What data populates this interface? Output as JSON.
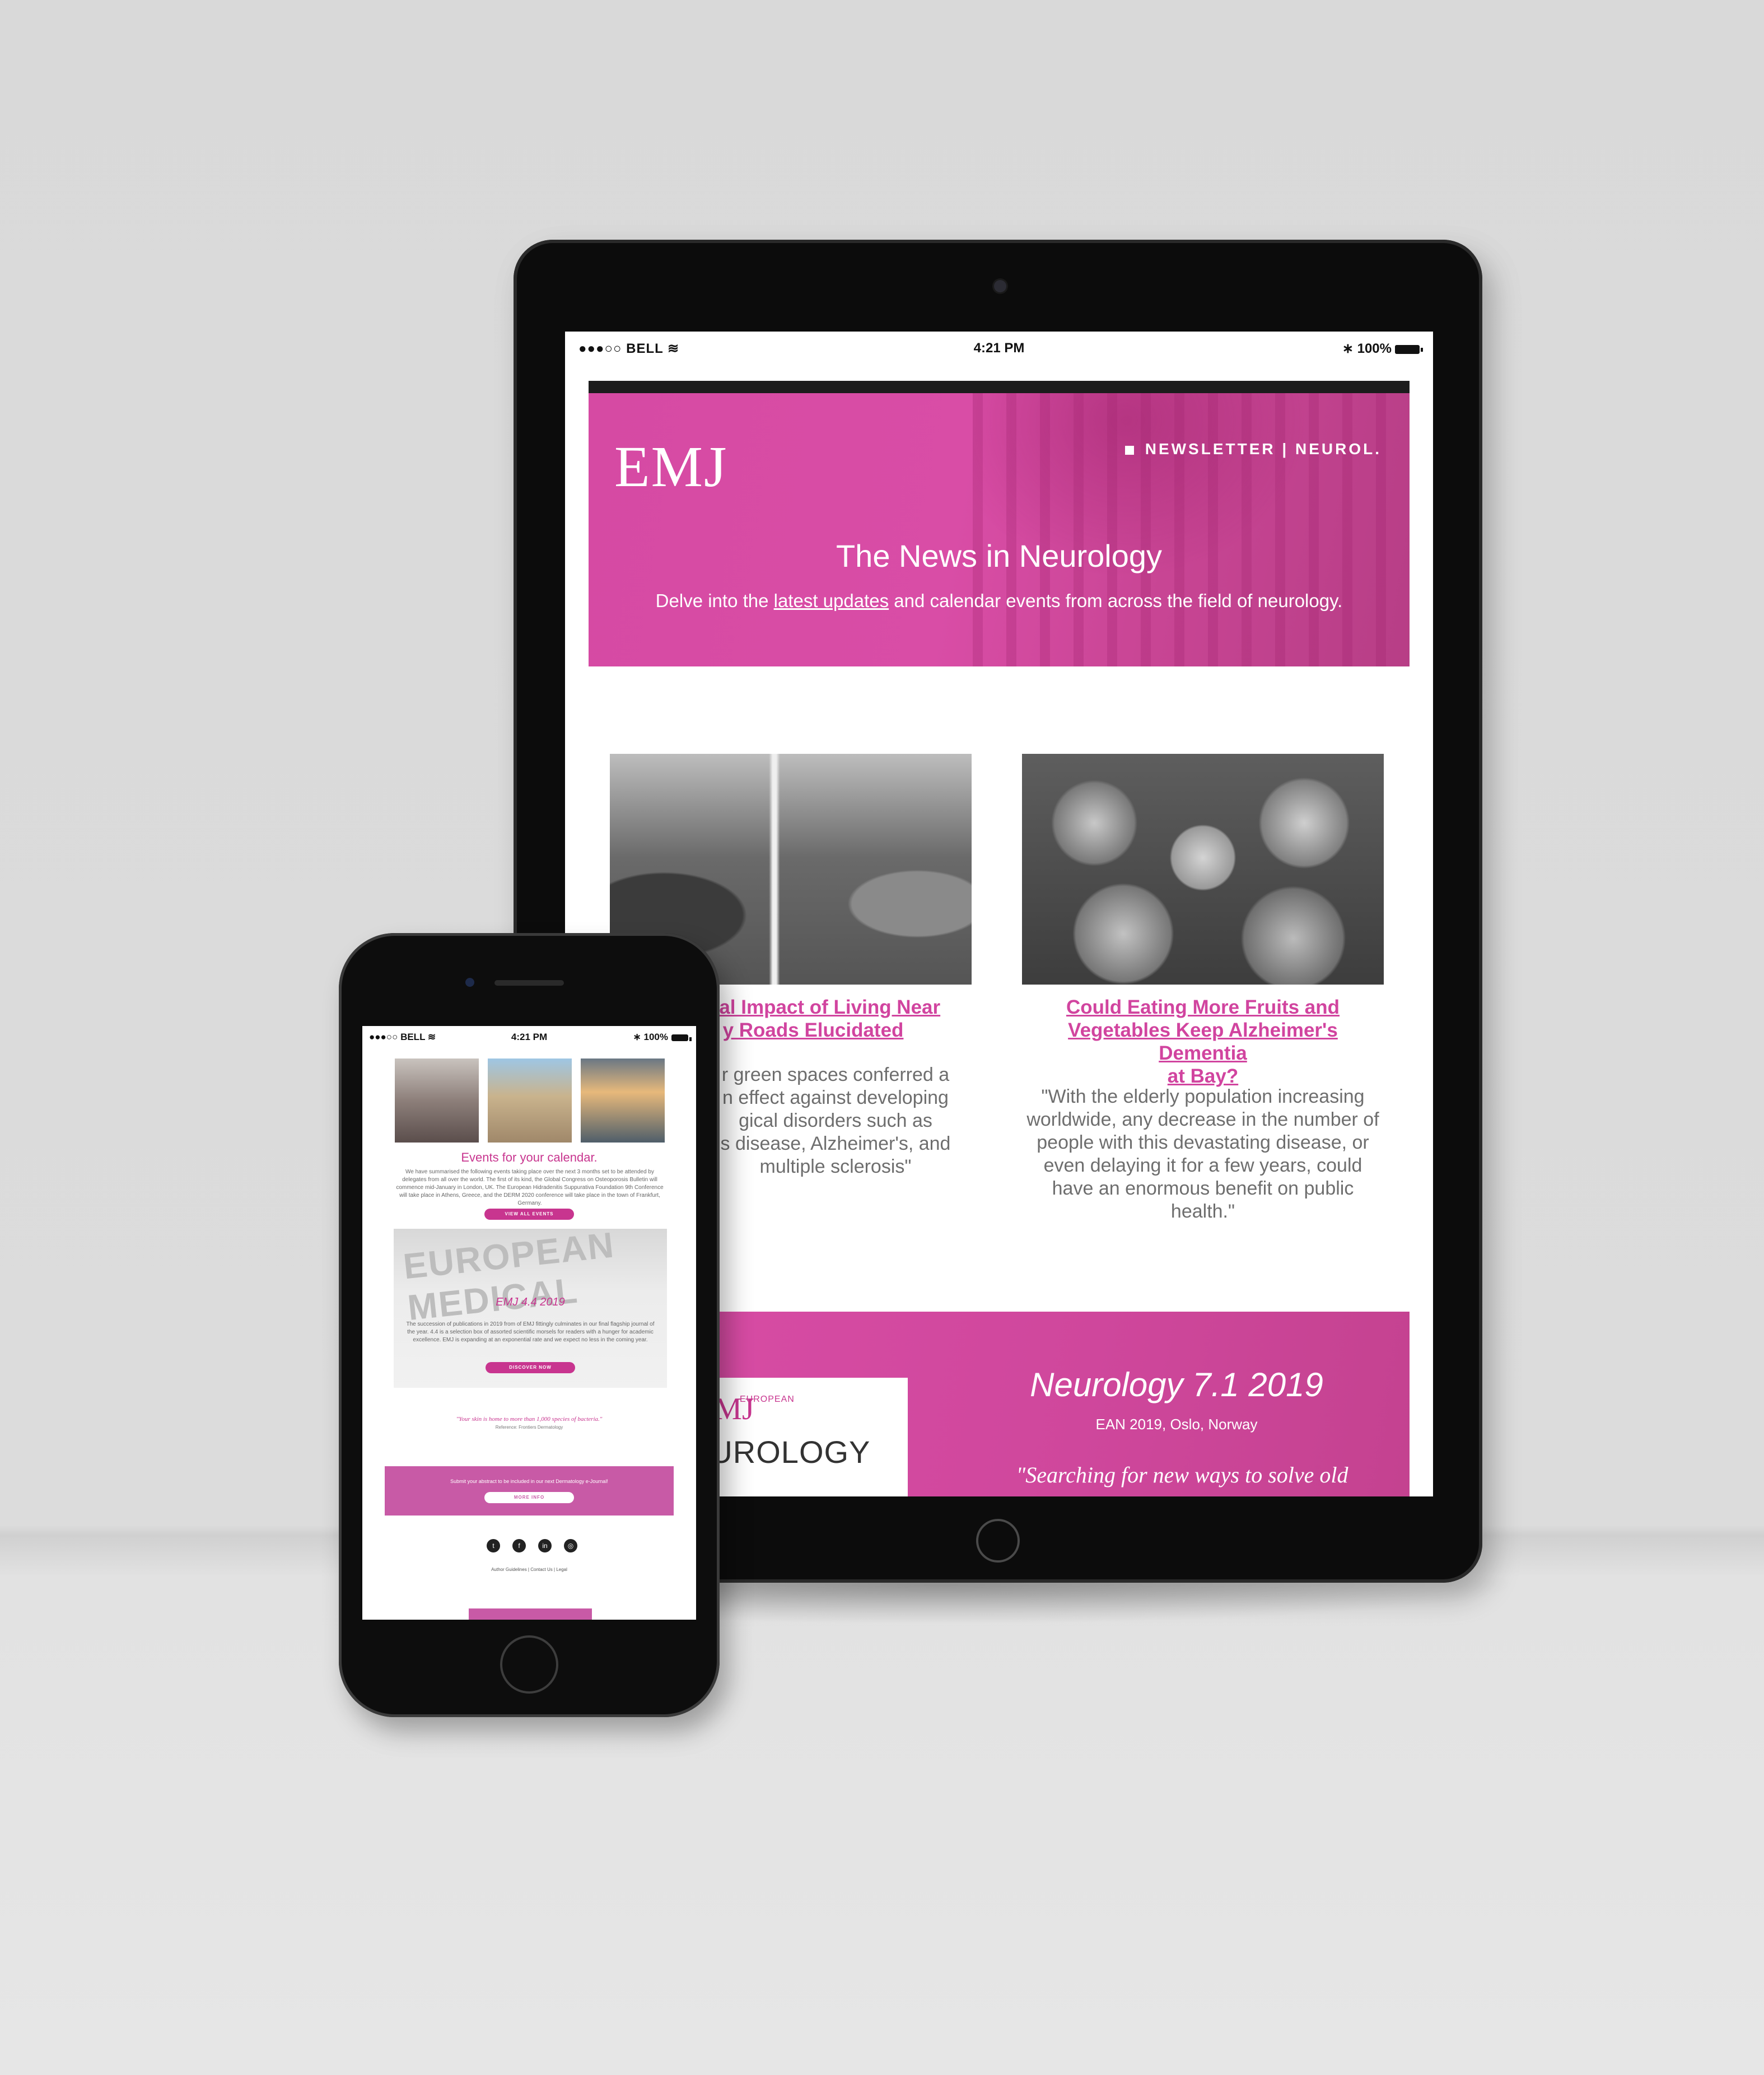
{
  "tablet": {
    "status": {
      "carrier": "●●●○○ BELL",
      "time": "4:21 PM",
      "battery": "100%"
    },
    "header": {
      "logo": "EMJ",
      "label": "NEWSLETTER | NEUROL.",
      "title": "The News in Neurology",
      "subtitle_pre": "Delve into the ",
      "subtitle_link": "latest updates",
      "subtitle_post": " and calendar events from across the field of neurology."
    },
    "articles": [
      {
        "title_l1": "cal Impact of Living Near",
        "title_l2": "y Roads Elucidated",
        "body_lines": [
          "r green spaces conferred a",
          "n effect against developing",
          "gical disorders such as",
          "s disease, Alzheimer's, and",
          "multiple sclerosis\""
        ]
      },
      {
        "title_l1": "Could Eating More Fruits and",
        "title_l2": "Vegetables Keep Alzheimer's Dementia",
        "title_l3": "at Bay?",
        "body_lines": [
          "\"With the elderly population increasing",
          "worldwide, any decrease in the number of",
          "people with this devastating disease, or",
          "even delaying it for a few years, could",
          "have an enormous benefit on public",
          "health.\""
        ]
      }
    ],
    "footer": {
      "cover_brand": "EMJ",
      "cover_publisher": "EUROPEAN",
      "cover_title": "EUROLOGY",
      "title": "Neurology 7.1 2019",
      "subtitle": "EAN 2019, Oslo, Norway",
      "quote": "\"Searching for new ways to solve old"
    }
  },
  "phone": {
    "status": {
      "carrier": "●●●○○ BELL",
      "time": "4:21 PM",
      "battery": "100%"
    },
    "events_title": "Events for your calendar.",
    "events_text": "We have summarised the following events taking place over the next 3 months set to be attended by delegates from all over the world. The first of its kind, the Global Congress on Osteoporosis Bulletin will commence mid-January in London, UK. The European Hidradenitis Suppurativa Foundation 9th Conference will take place in Athens, Greece, and the DERM 2020 conference will take place in the town of Frankfurt, Germany.",
    "events_button": "VIEW ALL EVENTS",
    "journal_image_text": "EUROPEAN MEDICAL",
    "journal_title": "EMJ 4.4 2019",
    "journal_text": "The succession of publications in 2019 from of EMJ fittingly culminates in our final flagship journal of the year. 4.4 is a selection box of assorted scientific morsels for readers with a hunger for academic excellence. EMJ is expanding at an exponential rate and we expect no less in the coming year.",
    "journal_button": "DISCOVER NOW",
    "quote": "\"Your skin is home to more than 1,000 species of bacteria.\"",
    "quote_ref": "Reference: Frontiers Dermatology",
    "band_text": "Submit your abstract to be included in our next Dermatology e-Journal!",
    "band_button": "MORE INFO",
    "social_icons": [
      "twitter-icon",
      "facebook-icon",
      "linkedin-icon",
      "instagram-icon"
    ],
    "links": "Author Guidelines  |  Contact Us  |  Legal"
  },
  "colors": {
    "accent": "#d94da6",
    "dark_accent": "#c8358f"
  }
}
